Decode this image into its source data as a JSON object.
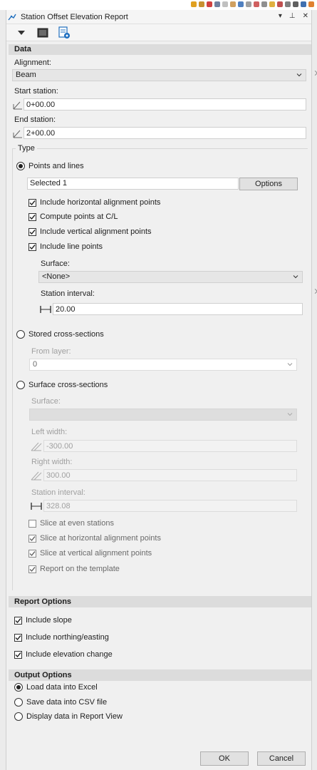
{
  "colors": {
    "accent_blue": "#1f6fbf",
    "section_bg": "#dcdcdc",
    "panel_bg": "#f0f0f0"
  },
  "window": {
    "title": "Station Offset Elevation Report",
    "title_icon": "report-app-icon"
  },
  "toolbar": {
    "menu_icon": "dropdown-arrow-icon",
    "view_icon": "image-view-icon",
    "report_icon": "report-settings-icon"
  },
  "data_section": {
    "header": "Data",
    "alignment_label": "Alignment:",
    "alignment_value": "Beam",
    "start_station_label": "Start station:",
    "start_station_value": "0+00.00",
    "end_station_label": "End station:",
    "end_station_value": "2+00.00"
  },
  "type_section": {
    "label": "Type",
    "points_and_lines": {
      "label": "Points and lines",
      "selected": true,
      "selected_text": "Selected 1",
      "options_button": "Options",
      "checks": [
        {
          "label": "Include horizontal alignment points",
          "checked": true
        },
        {
          "label": "Compute points at C/L",
          "checked": true
        },
        {
          "label": "Include vertical alignment points",
          "checked": true
        },
        {
          "label": "Include line points",
          "checked": true
        }
      ],
      "surface_label": "Surface:",
      "surface_value": "<None>",
      "station_interval_label": "Station interval:",
      "station_interval_value": "20.00"
    },
    "stored_cross_sections": {
      "label": "Stored cross-sections",
      "selected": false,
      "from_layer_label": "From layer:",
      "from_layer_value": "0"
    },
    "surface_cross_sections": {
      "label": "Surface cross-sections",
      "selected": false,
      "surface_label": "Surface:",
      "surface_value": "",
      "left_width_label": "Left width:",
      "left_width_value": "-300.00",
      "right_width_label": "Right width:",
      "right_width_value": "300.00",
      "station_interval_label": "Station interval:",
      "station_interval_value": "328.08",
      "checks": [
        {
          "label": "Slice at even stations",
          "checked": false
        },
        {
          "label": "Slice at horizontal alignment points",
          "checked": true
        },
        {
          "label": "Slice at vertical alignment points",
          "checked": true
        },
        {
          "label": "Report on the template",
          "checked": true
        }
      ]
    }
  },
  "report_options": {
    "header": "Report Options",
    "checks": [
      {
        "label": "Include slope",
        "checked": true
      },
      {
        "label": "Include northing/easting",
        "checked": true
      },
      {
        "label": "Include elevation change",
        "checked": true
      }
    ]
  },
  "output_options": {
    "header": "Output Options",
    "radios": [
      {
        "label": "Load data into Excel",
        "selected": true
      },
      {
        "label": "Save data into CSV file",
        "selected": false
      },
      {
        "label": "Display data in Report View",
        "selected": false
      }
    ]
  },
  "footer": {
    "ok_label": "OK",
    "cancel_label": "Cancel"
  }
}
